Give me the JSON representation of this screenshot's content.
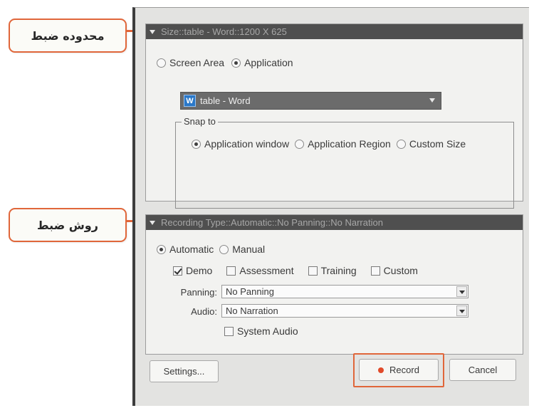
{
  "callouts": {
    "capture_area": "محدوده ضبط",
    "recording_method": "روش ضبط"
  },
  "size_panel": {
    "header": "Size::table - Word::1200 X 625",
    "screen_area_label": "Screen Area",
    "application_label": "Application",
    "selected_mode": "Application",
    "app_select_value": "table - Word",
    "app_icon_glyph": "W",
    "snap_legend": "Snap to",
    "snap_options": [
      "Application window",
      "Application Region",
      "Custom Size"
    ],
    "snap_selected": "Application window"
  },
  "recording_panel": {
    "header": "Recording Type::Automatic::No Panning::No Narration",
    "automatic_label": "Automatic",
    "manual_label": "Manual",
    "selected_type": "Automatic",
    "modes": [
      {
        "label": "Demo",
        "checked": true
      },
      {
        "label": "Assessment",
        "checked": false
      },
      {
        "label": "Training",
        "checked": false
      },
      {
        "label": "Custom",
        "checked": false
      }
    ],
    "panning_label": "Panning:",
    "panning_value": "No Panning",
    "audio_label": "Audio:",
    "audio_value": "No Narration",
    "system_audio_label": "System Audio",
    "system_audio_checked": false
  },
  "footer": {
    "settings_label": "Settings...",
    "record_label": "Record",
    "cancel_label": "Cancel"
  },
  "colors": {
    "callout_border": "#e0663a",
    "header_bg": "#4f4f4f",
    "record_dot": "#e14a2a"
  }
}
